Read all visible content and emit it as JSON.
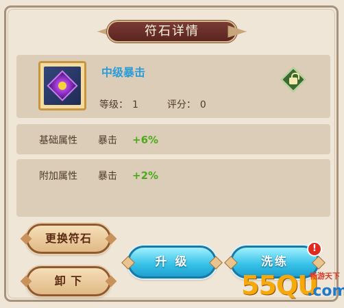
{
  "panel": {
    "title": "符石详情"
  },
  "item": {
    "name": "中级暴击",
    "level_label": "等级：",
    "level_value": "1",
    "score_label": "评分：",
    "score_value": "0"
  },
  "attributes": {
    "base": {
      "label": "基础属性",
      "stat": "暴击",
      "value": "+6%"
    },
    "extra": {
      "label": "附加属性",
      "stat": "暴击",
      "value": "+2%"
    }
  },
  "buttons": {
    "replace": "更换符石",
    "unequip": "卸 下",
    "upgrade": "升 级",
    "refine": "洗练"
  },
  "refine_alert": "!",
  "watermark": {
    "main": "55QU",
    "domain": ".com",
    "tag": "畅游天下"
  },
  "colors": {
    "title_ribbon": "#5a2520",
    "item_name": "#2b9bd6",
    "bonus_value": "#4caa1c",
    "blue_button": "#35c0e6"
  }
}
